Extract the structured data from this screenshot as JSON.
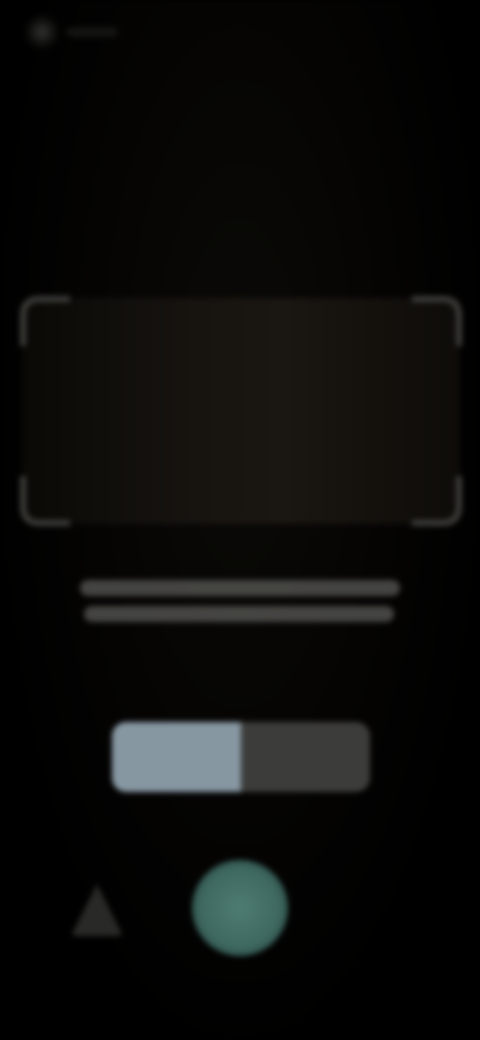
{
  "header": {
    "back_icon": "back-arrow-icon"
  },
  "scanner": {
    "instruction": ""
  },
  "mode_switch": {
    "options": [
      {
        "label": "",
        "state": "active"
      },
      {
        "label": "",
        "state": "inactive"
      }
    ]
  },
  "controls": {
    "flash_icon": "flash-icon",
    "shutter_icon": "shutter-icon"
  },
  "colors": {
    "background": "#000000",
    "active_mode": "#8797a2",
    "inactive_mode": "#3c3c3a",
    "shutter": "#4e7b72"
  }
}
